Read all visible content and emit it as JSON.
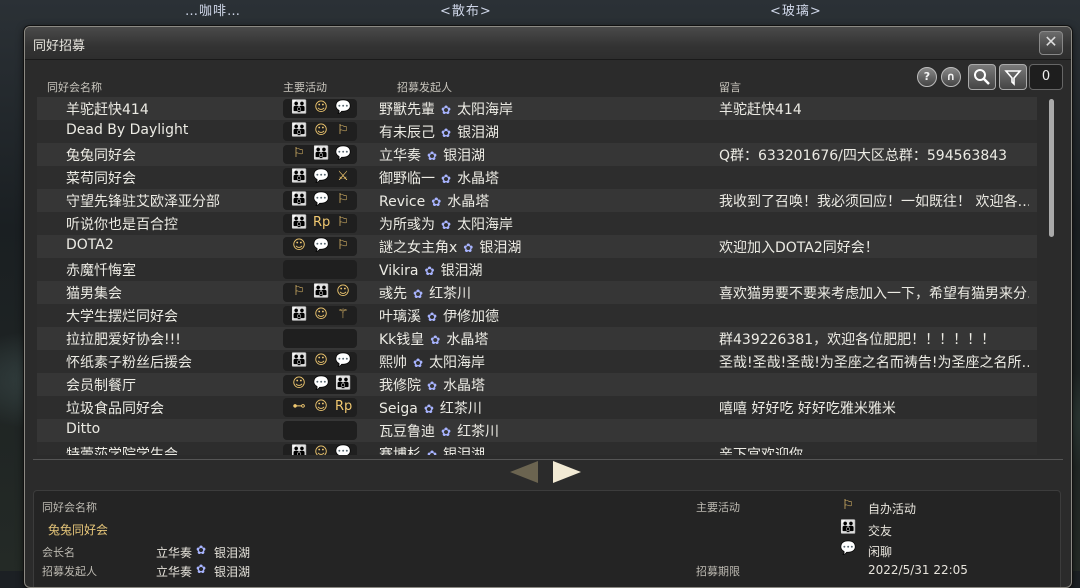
{
  "background": {
    "banner_left": "…咖啡…",
    "banner_center": "<散布>",
    "banner_right": "<玻璃>"
  },
  "window": {
    "title": "同好招募",
    "close_icon": "close-icon"
  },
  "columns": {
    "name": "同好会名称",
    "activity": "主要活动",
    "recruiter": "招募发起人",
    "message": "留言"
  },
  "toolbar": {
    "help_label": "?",
    "headset_label": "∩",
    "search_label": "🔍",
    "filter_label": "✎",
    "count": "0"
  },
  "rows": [
    {
      "name": "羊驼赶快414",
      "acts": [
        "👪",
        "☺",
        "💬"
      ],
      "recruiter": "野獸先輩",
      "world": "太阳海岸",
      "message": "羊驼赶快414"
    },
    {
      "name": "Dead By Daylight",
      "acts": [
        "👪",
        "☺",
        "⚐"
      ],
      "recruiter": "有未辰己",
      "world": "银泪湖",
      "message": ""
    },
    {
      "name": "兔兔同好会",
      "acts": [
        "⚐",
        "👪",
        "💬"
      ],
      "recruiter": "立华奏",
      "world": "银泪湖",
      "message": "Q群：633201676/四大区总群：594563843"
    },
    {
      "name": "菜苟同好会",
      "acts": [
        "👪",
        "💬",
        "⚔"
      ],
      "recruiter": "御野临一",
      "world": "水晶塔",
      "message": ""
    },
    {
      "name": "守望先锋驻艾欧泽亚分部",
      "acts": [
        "👪",
        "💬",
        "⚐"
      ],
      "recruiter": "Revice",
      "world": "水晶塔",
      "message": "我收到了召唤！我必须回应！一如既往！ 欢迎各…"
    },
    {
      "name": "听说你也是百合控",
      "acts": [
        "👪",
        "Rp",
        "⚐"
      ],
      "recruiter": "为所彧为",
      "world": "太阳海岸",
      "message": ""
    },
    {
      "name": "DOTA2",
      "acts": [
        "☺",
        "💬",
        "⚐"
      ],
      "recruiter": "謎之女主角x",
      "world": "银泪湖",
      "message": "欢迎加入DOTA2同好会！"
    },
    {
      "name": "赤魔忏悔室",
      "acts": [],
      "recruiter": "Vikira",
      "world": "银泪湖",
      "message": ""
    },
    {
      "name": "猫男集会",
      "acts": [
        "⚐",
        "👪",
        "☺"
      ],
      "recruiter": "彧先",
      "world": "红茶川",
      "message": "喜欢猫男要不要来考虑加入一下，希望有猫男来分…"
    },
    {
      "name": "大学生摆烂同好会",
      "acts": [
        "👪",
        "☺",
        "⚚"
      ],
      "recruiter": "叶璃溪",
      "world": "伊修加德",
      "message": ""
    },
    {
      "name": "拉拉肥爱好协会!!!",
      "acts": [],
      "recruiter": "Kk钱皇",
      "world": "水晶塔",
      "message": "群439226381，欢迎各位肥肥！！！！！！"
    },
    {
      "name": "怀纸素子粉丝后援会",
      "acts": [
        "👪",
        "☺",
        "💬"
      ],
      "recruiter": "熙帅",
      "world": "太阳海岸",
      "message": "圣哉!圣哉!圣哉!为圣座之名而祷告!为圣座之名所…"
    },
    {
      "name": "会员制餐厅",
      "acts": [
        "☺",
        "💬",
        "👪"
      ],
      "recruiter": "我修院",
      "world": "水晶塔",
      "message": ""
    },
    {
      "name": "垃圾食品同好会",
      "acts": [
        "⊷",
        "☺",
        "Rp"
      ],
      "recruiter": "Seiga",
      "world": "红茶川",
      "message": "嘻嘻 好好吃 好好吃雅米雅米"
    },
    {
      "name": "Ditto",
      "acts": [],
      "recruiter": "瓦豆鲁迪",
      "world": "红茶川",
      "message": ""
    },
    {
      "name": "特蕾莎学院学生会",
      "acts": [
        "👪",
        "☺",
        "💬"
      ],
      "recruiter": "赛博杉",
      "world": "银泪湖",
      "message": "亲下宫欢迎你"
    }
  ],
  "detail": {
    "name_label": "同好会名称",
    "name_value": "兔兔同好会",
    "leader_label": "会长名",
    "leader_value": "立华奏",
    "leader_world": "银泪湖",
    "recruiter_label": "招募发起人",
    "recruiter_value": "立华奏",
    "recruiter_world": "银泪湖",
    "activity_label": "主要活动",
    "activities": [
      {
        "icon": "⚐",
        "label": "自办活动"
      },
      {
        "icon": "👪",
        "label": "交友"
      },
      {
        "icon": "💬",
        "label": "闲聊"
      }
    ],
    "period_label": "招募期限",
    "period_value": "2022/5/31 22:05"
  },
  "scrollbar": {
    "position_fraction": 0.0
  }
}
